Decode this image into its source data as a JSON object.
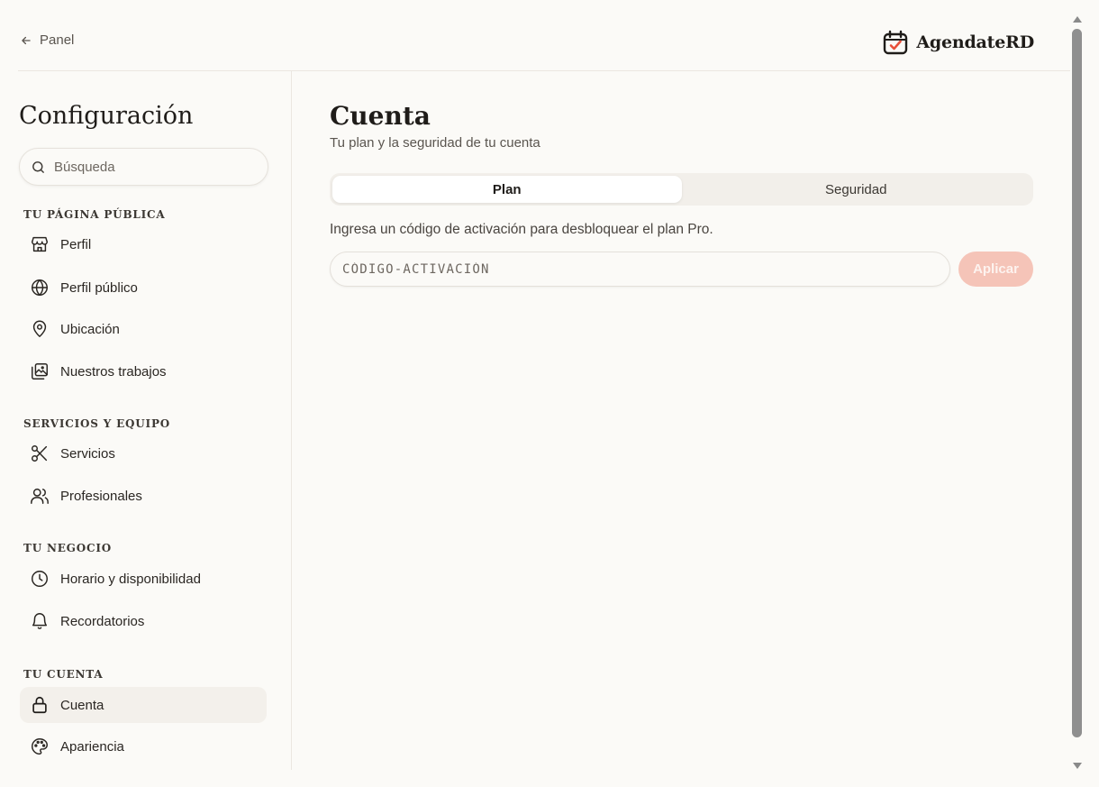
{
  "topbar": {
    "back_label": "Panel",
    "brand_name": "AgendateRD"
  },
  "sidebar": {
    "title": "Configuración",
    "search_placeholder": "Búsqueda",
    "sections": [
      {
        "label": "TU PÁGINA PÚBLICA",
        "items": [
          {
            "label": "Perfil",
            "icon": "store-icon"
          },
          {
            "label": "Perfil público",
            "icon": "globe-icon"
          },
          {
            "label": "Ubicación",
            "icon": "map-pin-icon"
          },
          {
            "label": "Nuestros trabajos",
            "icon": "images-icon"
          }
        ]
      },
      {
        "label": "SERVICIOS Y EQUIPO",
        "items": [
          {
            "label": "Servicios",
            "icon": "scissors-icon"
          },
          {
            "label": "Profesionales",
            "icon": "users-icon"
          }
        ]
      },
      {
        "label": "TU NEGOCIO",
        "items": [
          {
            "label": "Horario y disponibilidad",
            "icon": "clock-icon"
          },
          {
            "label": "Recordatorios",
            "icon": "bell-icon"
          }
        ]
      },
      {
        "label": "TU CUENTA",
        "items": [
          {
            "label": "Cuenta",
            "icon": "lock-icon",
            "active": true
          },
          {
            "label": "Apariencia",
            "icon": "palette-icon"
          }
        ]
      }
    ]
  },
  "main": {
    "title": "Cuenta",
    "subtitle": "Tu plan y la seguridad de tu cuenta",
    "tabs": [
      {
        "label": "Plan",
        "active": true
      },
      {
        "label": "Seguridad",
        "active": false
      }
    ],
    "activation_text": "Ingresa un código de activación para desbloquear el plan Pro.",
    "code_placeholder": "CÓDIGO-ACTIVACIÓN",
    "code_value": "",
    "apply_label": "Aplicar"
  },
  "colors": {
    "background": "#fbfaf7",
    "accent": "#e8503a",
    "apply_disabled": "#f5c4b8"
  }
}
